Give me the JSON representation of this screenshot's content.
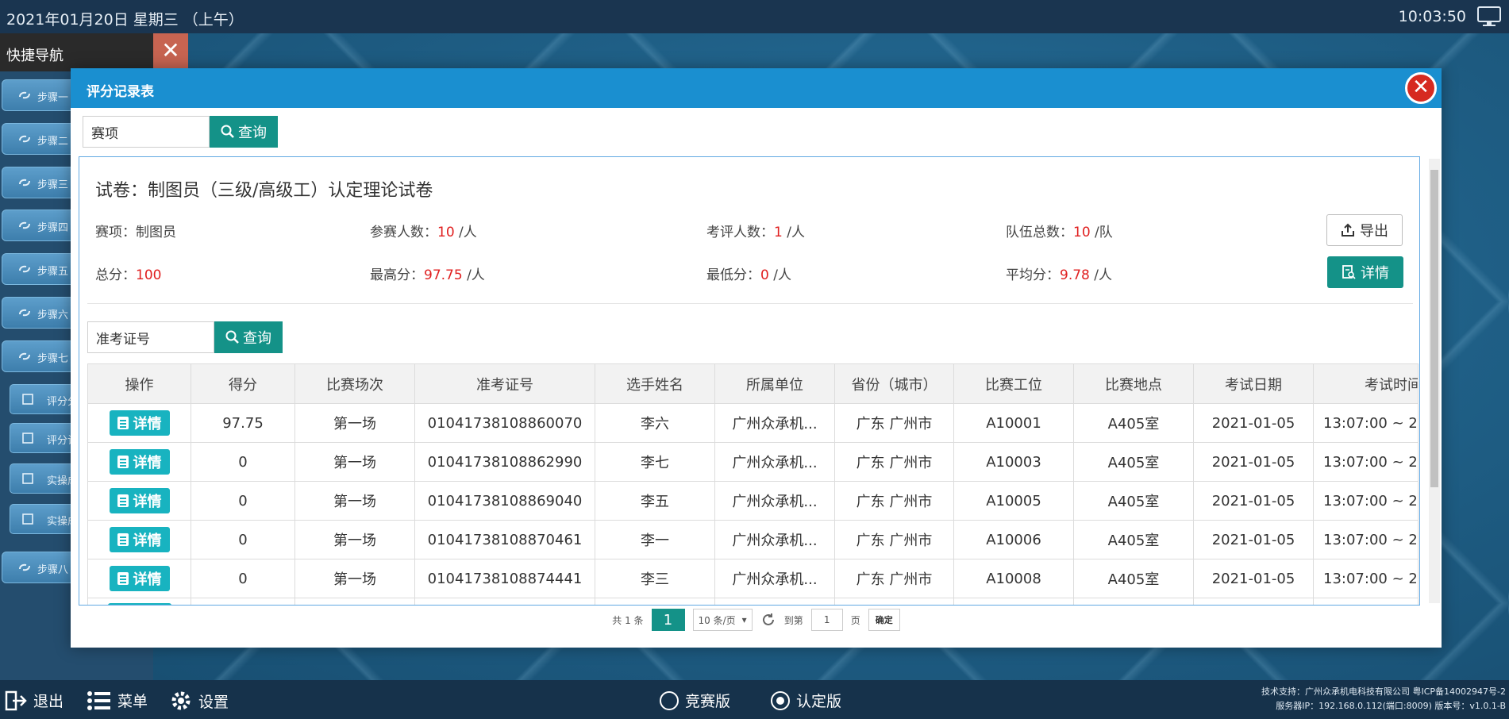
{
  "topbar": {
    "date": "2021年01月20日  星期三  （上午）",
    "time": "10:03:50"
  },
  "leftnav": {
    "title": "快捷导航",
    "steps": [
      "步骤一",
      "步骤二",
      "步骤三",
      "步骤四",
      "步骤五",
      "步骤六",
      "步骤七"
    ],
    "subitems": [
      "评分分",
      "评分记",
      "实操成",
      "实操成"
    ],
    "step8": "步骤八"
  },
  "modal": {
    "title": "评分记录表",
    "search_placeholder": "赛项",
    "search_button": "查询",
    "paper_title": "试卷：制图员（三级/高级工）认定理论试卷",
    "info": {
      "event_label": "赛项：",
      "event_value": "制图员",
      "participants_label": "参赛人数：",
      "participants_value": "10",
      "participants_unit": "/人",
      "reviewers_label": "考评人数：",
      "reviewers_value": "1",
      "reviewers_unit": "/人",
      "teams_label": "队伍总数：",
      "teams_value": "10",
      "teams_unit": "/队",
      "total_label": "总分：",
      "total_value": "100",
      "max_label": "最高分：",
      "max_value": "97.75",
      "max_unit": "/人",
      "min_label": "最低分：",
      "min_value": "0",
      "min_unit": "/人",
      "avg_label": "平均分：",
      "avg_value": "9.78",
      "avg_unit": "/人"
    },
    "export_button": "导出",
    "detail_button": "详情",
    "ticket_placeholder": "准考证号",
    "ticket_search_button": "查询",
    "table": {
      "headers": [
        "操作",
        "得分",
        "比赛场次",
        "准考证号",
        "选手姓名",
        "所属单位",
        "省份（城市）",
        "比赛工位",
        "比赛地点",
        "考试日期",
        "考试时间"
      ],
      "row_button": "详情",
      "rows": [
        [
          "97.75",
          "第一场",
          "01041738108860070",
          "李六",
          "广州众承机...",
          "广东 广州市",
          "A10001",
          "A405室",
          "2021-01-05",
          "13:07:00 ~ 2"
        ],
        [
          "0",
          "第一场",
          "01041738108862990",
          "李七",
          "广州众承机...",
          "广东 广州市",
          "A10003",
          "A405室",
          "2021-01-05",
          "13:07:00 ~ 2"
        ],
        [
          "0",
          "第一场",
          "01041738108869040",
          "李五",
          "广州众承机...",
          "广东 广州市",
          "A10005",
          "A405室",
          "2021-01-05",
          "13:07:00 ~ 2"
        ],
        [
          "0",
          "第一场",
          "01041738108870461",
          "李一",
          "广州众承机...",
          "广东 广州市",
          "A10006",
          "A405室",
          "2021-01-05",
          "13:07:00 ~ 2"
        ],
        [
          "0",
          "第一场",
          "01041738108874441",
          "李三",
          "广州众承机...",
          "广东 广州市",
          "A10008",
          "A405室",
          "2021-01-05",
          "13:07:00 ~ 2"
        ]
      ]
    },
    "pager": {
      "total": "共 1 条",
      "current": "1",
      "per_page": "10 条/页",
      "goto": "到第",
      "page_input": "1",
      "page_unit": "页",
      "confirm": "确定"
    }
  },
  "bottombar": {
    "exit": "退出",
    "menu": "菜单",
    "settings": "设置",
    "mode_competition": "竞赛版",
    "mode_certify": "认定版",
    "support": "技术支持：广州众承机电科技有限公司  粤ICP备14002947号-2",
    "server": "服务器IP：192.168.0.112(端口:8009)  版本号：v1.0.1-B"
  }
}
